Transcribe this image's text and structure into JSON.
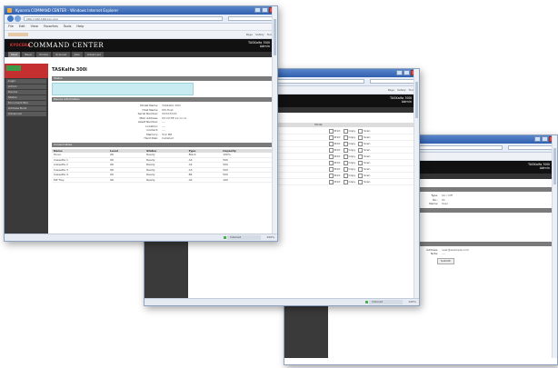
{
  "browser": {
    "title": "Kyocera COMMAND CENTER - Windows Internet Explorer",
    "url": "http://192.168.xxx.xxx/",
    "menu": [
      "File",
      "Edit",
      "View",
      "Favorites",
      "Tools",
      "Help"
    ],
    "tools": [
      "Page",
      "Safety",
      "Tools"
    ],
    "status_zone": "Internet",
    "status_zoom": "100%"
  },
  "app": {
    "logo": "KYOCERA",
    "brand": "COMMAND CENTER",
    "model_line1": "TASKalfa 300i",
    "model_line2": "Admin",
    "tabs": [
      "Start",
      "Basic",
      "Printer",
      "Scanner",
      "Jobs",
      "Advanced"
    ]
  },
  "win1": {
    "page_title": "TASKalfa 300i",
    "sidebar": [
      "Login",
      "Admin",
      "Device",
      "Status",
      "Document Box",
      "Address Book",
      "Advanced"
    ],
    "section1": "Status",
    "section2": "Device Information",
    "info": [
      {
        "k": "Model Name:",
        "v": "TASKalfa 300i"
      },
      {
        "k": "Host Name:",
        "v": "KM-Host"
      },
      {
        "k": "Serial Number:",
        "v": "XXXXXXXX"
      },
      {
        "k": "MAC Address:",
        "v": "00:C0:EE:xx:xx:xx"
      },
      {
        "k": "Asset Number:",
        "v": "----"
      },
      {
        "k": "Location:",
        "v": "----"
      },
      {
        "k": "Contact:",
        "v": "----"
      },
      {
        "k": "Memory:",
        "v": "512 MB"
      },
      {
        "k": "Hard Disk:",
        "v": "Installed"
      }
    ],
    "section3": "Consumables",
    "table_headers": [
      "Name",
      "Level",
      "Status",
      "Type",
      "Capacity"
    ],
    "table_rows": [
      [
        "Toner",
        "OK",
        "Ready",
        "Black",
        "100%"
      ],
      [
        "Cassette 1",
        "OK",
        "Ready",
        "A4",
        "500"
      ],
      [
        "Cassette 2",
        "OK",
        "Ready",
        "A4",
        "500"
      ],
      [
        "Cassette 3",
        "OK",
        "Ready",
        "A3",
        "500"
      ],
      [
        "Cassette 4",
        "OK",
        "Ready",
        "B4",
        "500"
      ],
      [
        "MP Tray",
        "OK",
        "Ready",
        "A4",
        "100"
      ]
    ]
  },
  "win2": {
    "title": "Kyocera COMMAND CENTER",
    "header_col": "Mode",
    "options": [
      "Print",
      "Copy",
      "Scan"
    ],
    "rows": [
      "Job 1",
      "Job 2",
      "Job 3",
      "Job 4",
      "Job 5",
      "Job 6",
      "Job 7",
      "Job 8",
      "Job 9"
    ]
  },
  "win3": {
    "title": "Kyocera COMMAND CENTER",
    "section1": "Settings",
    "fields": [
      {
        "k": "Type:",
        "v": "On / Off"
      },
      {
        "k": "No.:",
        "v": "01"
      },
      {
        "k": "Name:",
        "v": "User"
      }
    ],
    "section2": "Function",
    "func_opts": [
      "Function A",
      "Function B",
      "Function C",
      "Function D"
    ],
    "section3": "Details",
    "details": [
      {
        "k": "Address:",
        "v": "user@example.com"
      },
      {
        "k": "Note:",
        "v": "----"
      }
    ],
    "button": "Submit"
  }
}
